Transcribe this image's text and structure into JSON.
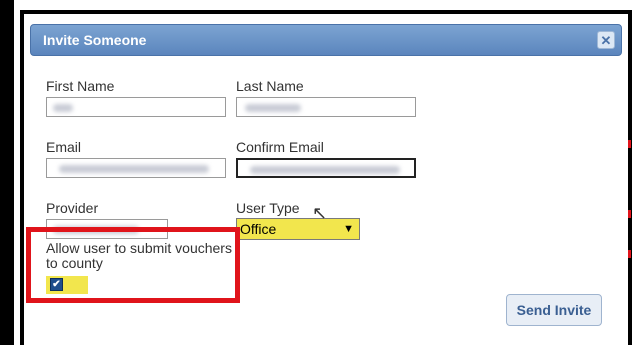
{
  "dialog": {
    "title": "Invite Someone",
    "close_icon": "close-icon",
    "fields": {
      "first_name_label": "First Name",
      "last_name_label": "Last Name",
      "email_label": "Email",
      "confirm_email_label": "Confirm Email",
      "provider_label": "Provider",
      "user_type_label": "User Type"
    },
    "user_type": {
      "selected": "Office"
    },
    "vouchers_label": "Allow user to submit vouchers to county",
    "vouchers_checked": true,
    "send_label": "Send Invite"
  },
  "colors": {
    "titlebar": "#5b85bd",
    "highlight": "#f2e64d",
    "callout": "#e0141b",
    "button_text": "#3a5f92"
  }
}
